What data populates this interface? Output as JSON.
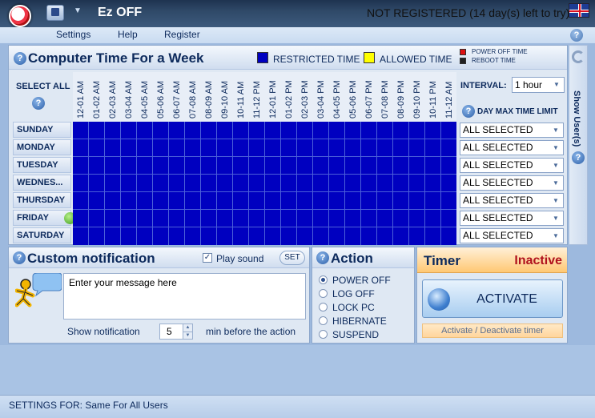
{
  "window": {
    "title": "Ez OFF",
    "registration": "NOT REGISTERED (14 day(s) left to try)"
  },
  "menu": {
    "items": [
      "Settings",
      "Help",
      "Register"
    ]
  },
  "week": {
    "title": "Computer Time For a Week",
    "legend_restricted": "RESTRICTED TIME",
    "legend_allowed": "ALLOWED TIME",
    "restricted_color": "#0000c0",
    "allowed_color": "#ffff00",
    "power_off_time": "POWER OFF TIME",
    "reboot_time": "REBOOT TIME",
    "select_all": "SELECT ALL",
    "hours": [
      "12-01 AM",
      "01-02 AM",
      "02-03 AM",
      "03-04 AM",
      "04-05 AM",
      "05-06 AM",
      "06-07 AM",
      "07-08 AM",
      "08-09 AM",
      "09-10 AM",
      "10-11 AM",
      "11-12 PM",
      "12-01 PM",
      "01-02 PM",
      "02-03 PM",
      "03-04 PM",
      "04-05 PM",
      "05-06 PM",
      "06-07 PM",
      "07-08 PM",
      "08-09 PM",
      "09-10 PM",
      "10-11 PM",
      "11-12 AM"
    ],
    "days": [
      "SUNDAY",
      "MONDAY",
      "TUESDAY",
      "WEDNES...",
      "THURSDAY",
      "FRIDAY",
      "SATURDAY"
    ],
    "interval_label": "INTERVAL:",
    "interval_value": "1 hour",
    "day_max_label": "DAY MAX TIME LIMIT",
    "day_max_values": [
      "ALL SELECTED",
      "ALL SELECTED",
      "ALL SELECTED",
      "ALL SELECTED",
      "ALL SELECTED",
      "ALL SELECTED",
      "ALL SELECTED"
    ]
  },
  "side": {
    "show_users": "Show User(s)"
  },
  "notification": {
    "title": "Custom notification",
    "play_sound": "Play sound",
    "play_sound_checked": true,
    "set": "SET",
    "message": "Enter your message here",
    "show_label": "Show notification",
    "minutes": "5",
    "min_before": "min before the action"
  },
  "action": {
    "title": "Action",
    "options": [
      "POWER OFF",
      "LOG OFF",
      "LOCK PC",
      "HIBERNATE",
      "SUSPEND"
    ],
    "selected": 0
  },
  "timer": {
    "title": "Timer",
    "status": "Inactive",
    "activate": "ACTIVATE",
    "toggle": "Activate / Deactivate timer"
  },
  "status": {
    "text": "SETTINGS FOR: Same For All Users"
  }
}
